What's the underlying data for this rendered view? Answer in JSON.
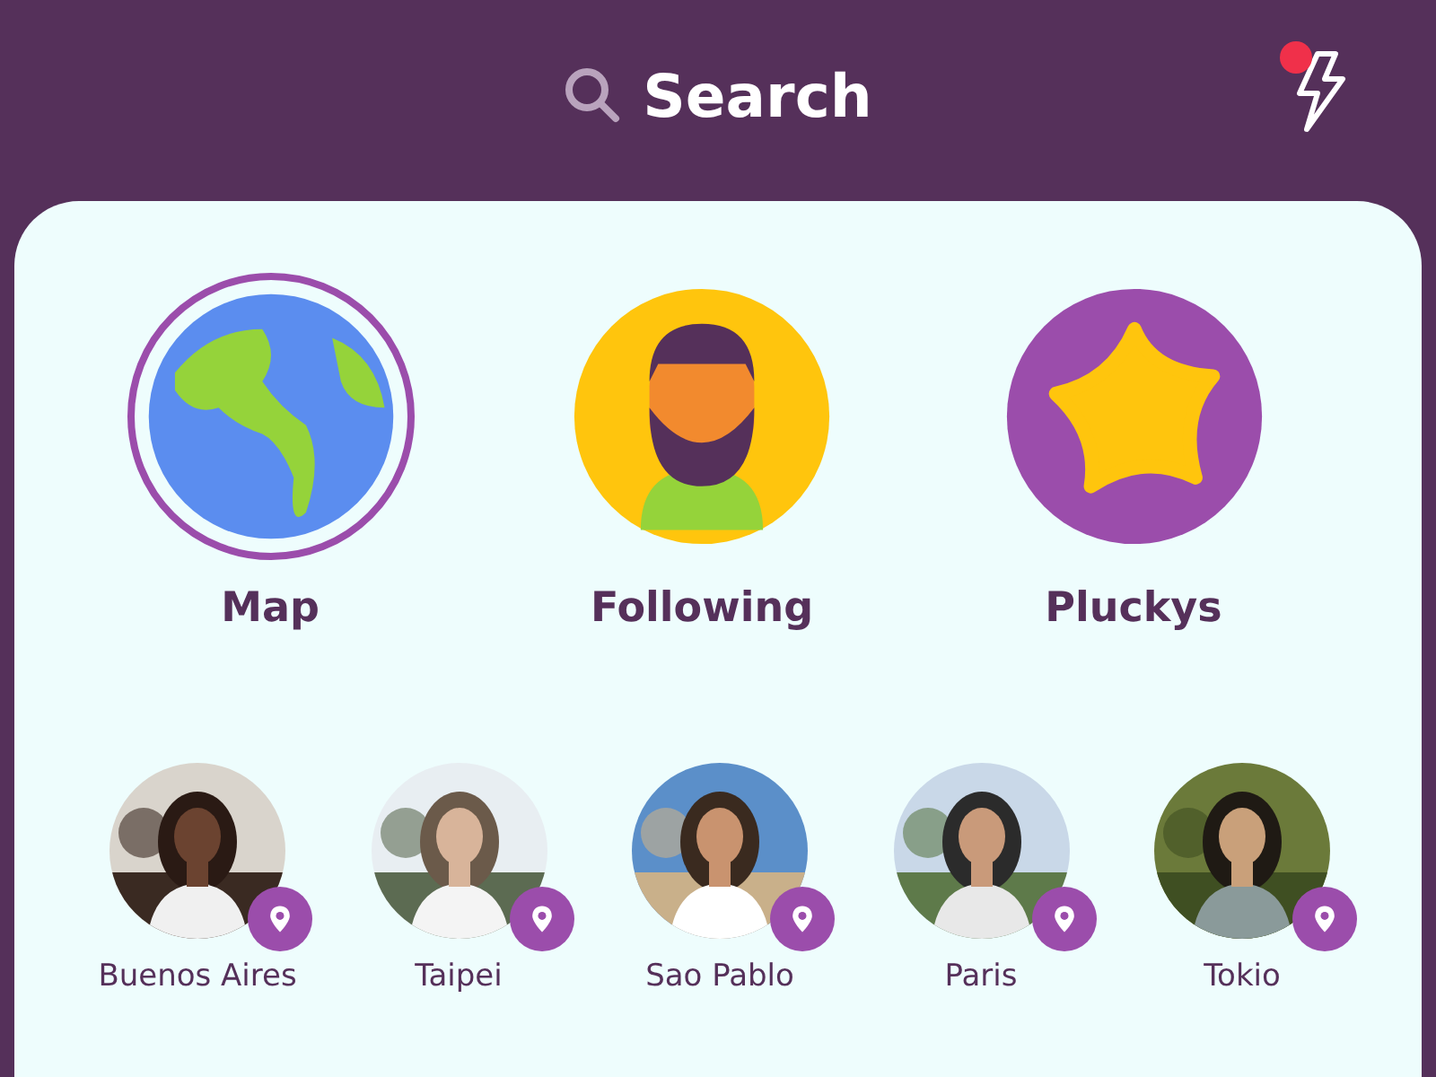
{
  "header": {
    "title": "Search",
    "has_notification": true
  },
  "categories": [
    {
      "label": "Map",
      "kind": "globe",
      "selected": true
    },
    {
      "label": "Following",
      "kind": "person",
      "selected": false
    },
    {
      "label": "Pluckys",
      "kind": "star",
      "selected": false
    }
  ],
  "places": [
    {
      "label": "Buenos Aires"
    },
    {
      "label": "Taipei"
    },
    {
      "label": "Sao Pablo"
    },
    {
      "label": "Paris"
    },
    {
      "label": "Tokio"
    }
  ]
}
